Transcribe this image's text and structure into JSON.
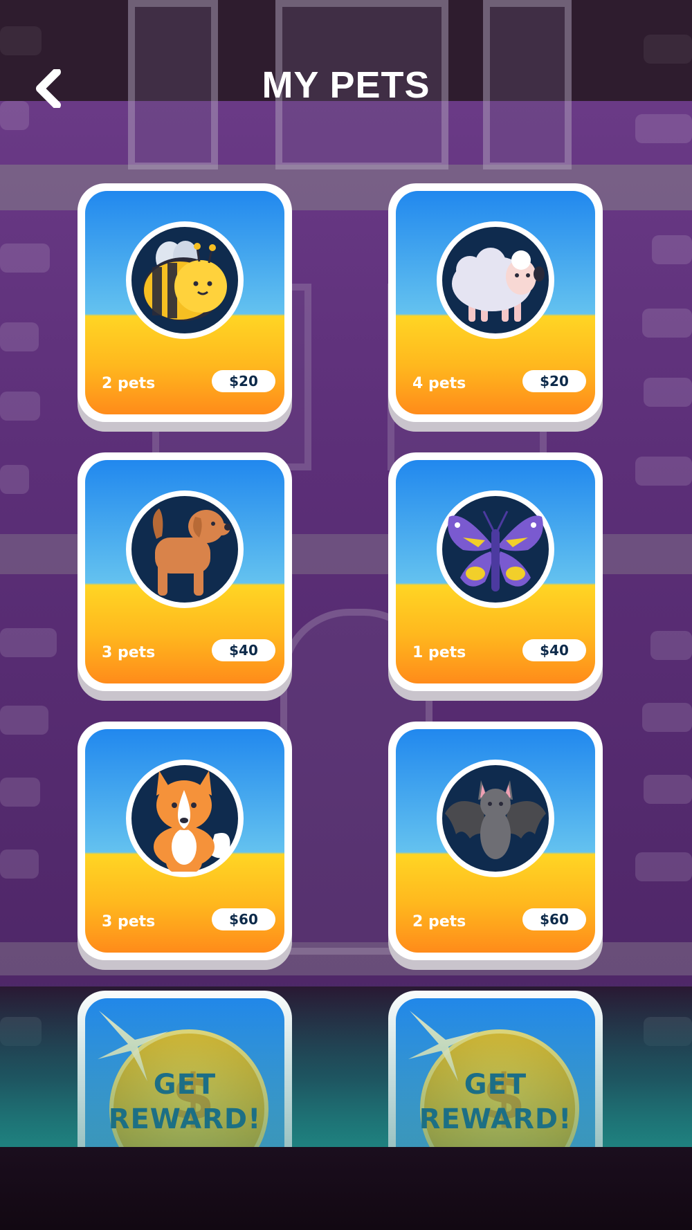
{
  "header": {
    "title": "MY PETS",
    "back_icon": "chevron-left-icon"
  },
  "pets": [
    {
      "animal": "bee",
      "count": "2 pets",
      "price": "$20"
    },
    {
      "animal": "sheep",
      "count": "4 pets",
      "price": "$20"
    },
    {
      "animal": "dog",
      "count": "3 pets",
      "price": "$40"
    },
    {
      "animal": "butterfly",
      "count": "1 pets",
      "price": "$40"
    },
    {
      "animal": "fox",
      "count": "3 pets",
      "price": "$60"
    },
    {
      "animal": "bat",
      "count": "2 pets",
      "price": "$60"
    }
  ],
  "rewards": [
    {
      "line1": "GET",
      "line2": "REWARD!"
    },
    {
      "line1": "GET",
      "line2": "REWARD!"
    }
  ],
  "colors": {
    "card_sky": "#2188ee",
    "card_ground": "#ffb81e",
    "pet_circle": "#0f2b4e",
    "background": "#5c2f78"
  }
}
